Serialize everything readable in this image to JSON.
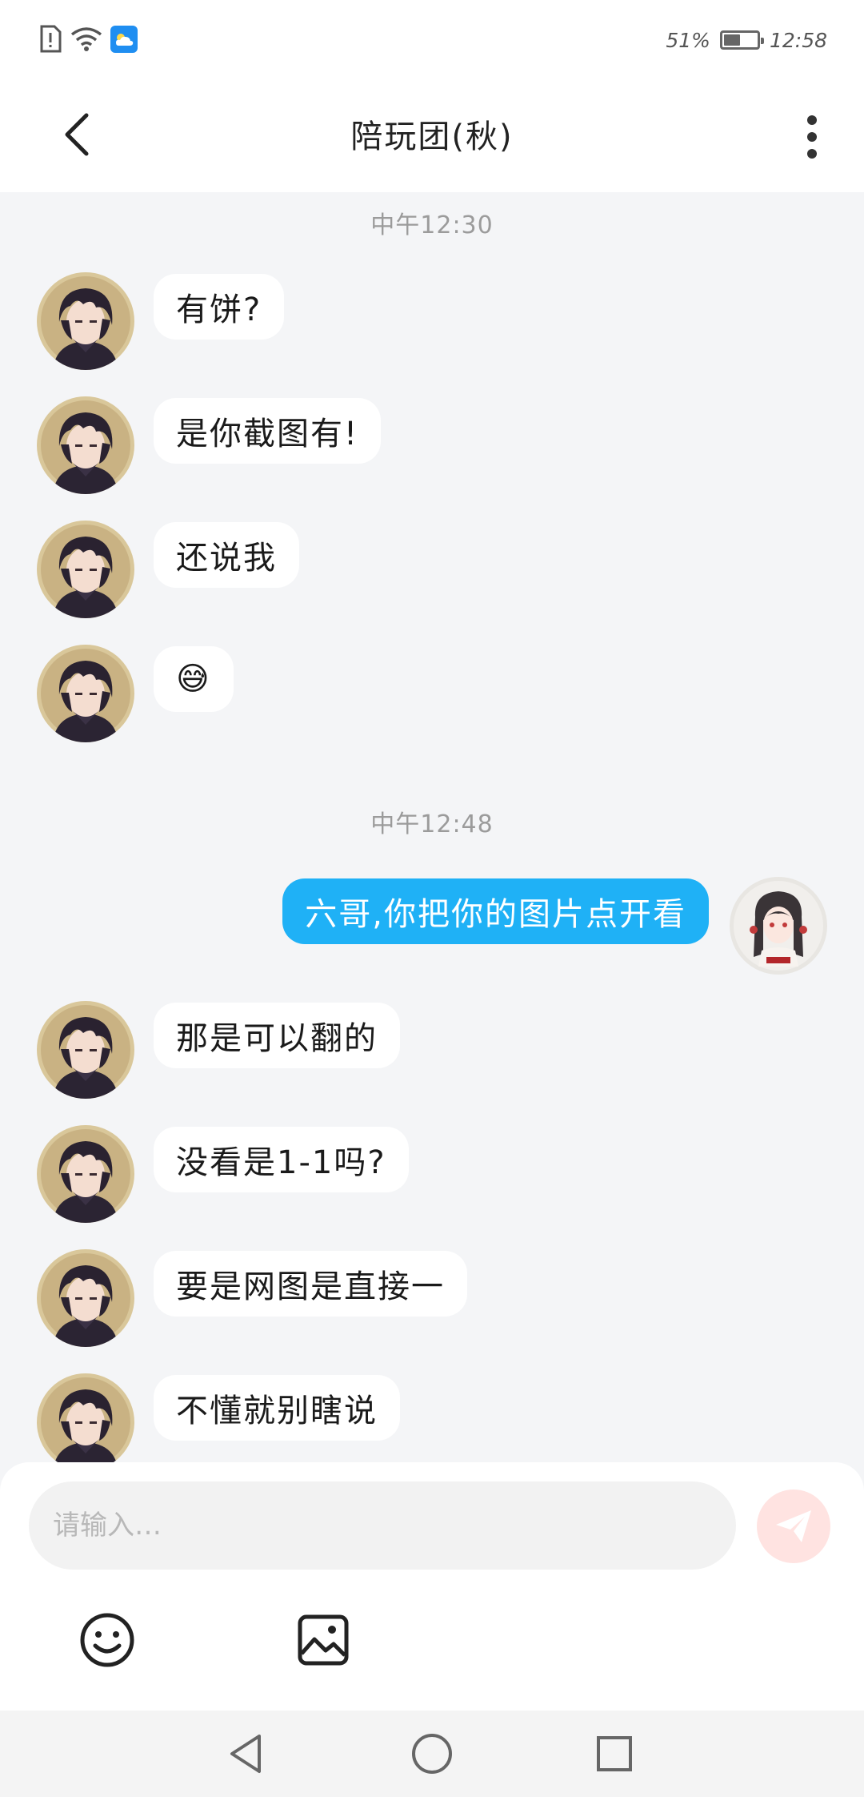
{
  "status_bar": {
    "battery_percent_text": "51%",
    "battery_level": 0.51,
    "time": "12:58",
    "icons": [
      "sim-alert-icon",
      "wifi-icon",
      "weather-icon"
    ]
  },
  "header": {
    "title": "陪玩团(秋)",
    "back_icon": "chevron-left-icon",
    "more_icon": "vertical-dots-icon"
  },
  "chat": {
    "time_labels": [
      "中午12:30",
      "中午12:48"
    ],
    "messages": [
      {
        "from": "other",
        "text": "有饼?"
      },
      {
        "from": "other",
        "text": "是你截图有!"
      },
      {
        "from": "other",
        "text": "还说我"
      },
      {
        "from": "other",
        "text": "😅"
      },
      {
        "from": "me",
        "text": "六哥,你把你的图片点开看"
      },
      {
        "from": "other",
        "text": "那是可以翻的"
      },
      {
        "from": "other",
        "text": "没看是1-1吗?"
      },
      {
        "from": "other",
        "text": "要是网图是直接一"
      },
      {
        "from": "other",
        "text": "不懂就别瞎说"
      }
    ]
  },
  "composer": {
    "placeholder": "请输入…",
    "send_icon": "paper-plane-icon",
    "tools": [
      "emoji-icon",
      "image-icon"
    ]
  },
  "colors": {
    "accent_bubble": "#1fb1f6",
    "send_button_bg": "#ffe3e1",
    "background": "#f4f5f7"
  },
  "nav": [
    "back-triangle-icon",
    "home-circle-icon",
    "recents-square-icon"
  ]
}
